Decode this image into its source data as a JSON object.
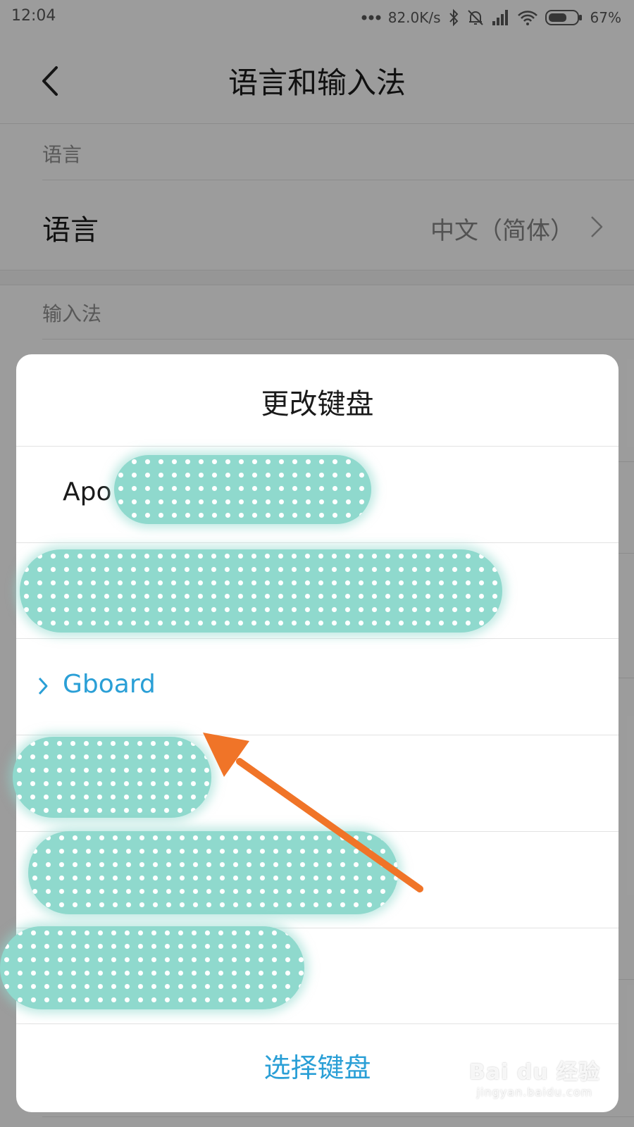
{
  "status_bar": {
    "time": "12:04",
    "network_speed": "82.0K/s",
    "battery_percent": "67%",
    "battery_level": 0.67,
    "icons": [
      "more-dots-icon",
      "bluetooth-icon",
      "alarm-off-icon",
      "signal-icon",
      "wifi-icon",
      "battery-icon"
    ]
  },
  "header": {
    "title": "语言和输入法",
    "back_icon": "chevron-left-icon"
  },
  "language_section": {
    "header": "语言",
    "row_label": "语言",
    "row_value": "中文（简体）"
  },
  "input_section": {
    "header": "输入法"
  },
  "dialog": {
    "title": "更改键盘",
    "options": [
      {
        "label": "Apo",
        "selected": false,
        "redacted": true
      },
      {
        "label": "",
        "selected": false,
        "redacted": true
      },
      {
        "label": "Gboard",
        "selected": true,
        "redacted": false
      },
      {
        "label": "",
        "selected": false,
        "redacted": true
      },
      {
        "label": "",
        "selected": false,
        "redacted": true
      },
      {
        "label": "",
        "selected": false,
        "redacted": true
      }
    ],
    "footer_button": "选择键盘"
  },
  "colors": {
    "accent": "#2a9fd6",
    "arrow": "#f07428",
    "redaction": "#8fd9cd"
  },
  "watermark": {
    "main": "Bai du 经验",
    "sub": "jingyan.baidu.com"
  }
}
